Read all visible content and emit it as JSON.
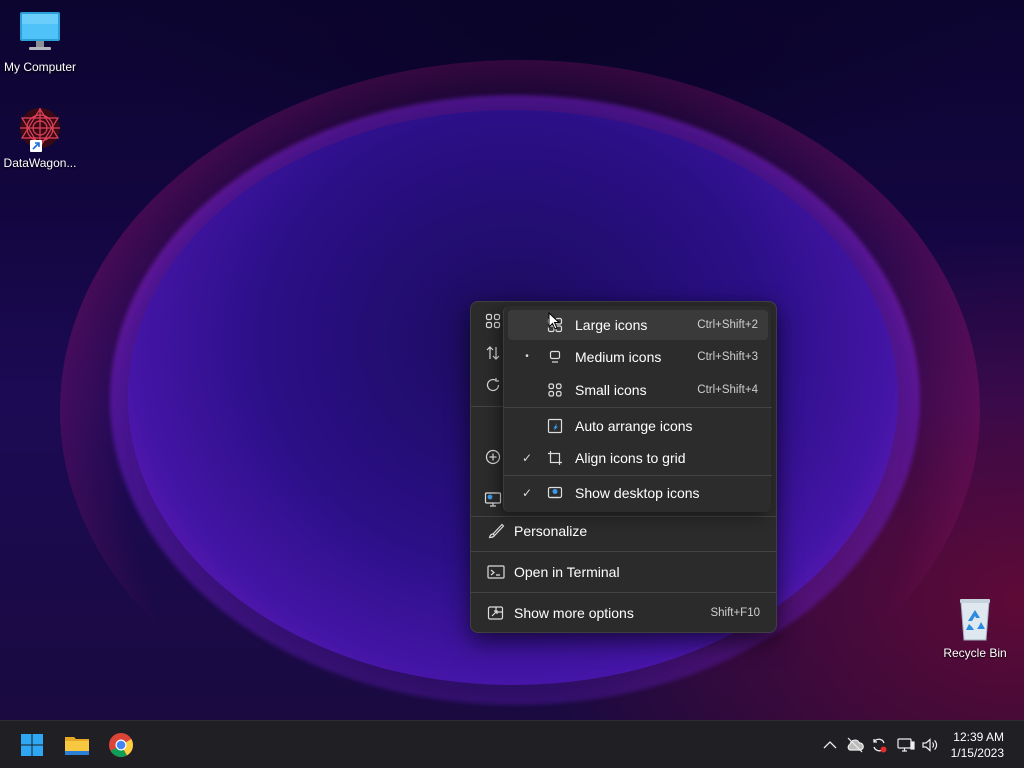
{
  "desktop": {
    "icons": [
      {
        "label": "My Computer"
      },
      {
        "label": "DataWagon..."
      },
      {
        "label": "Recycle Bin"
      }
    ]
  },
  "context_menu": {
    "view_submenu": {
      "items": [
        {
          "label": "Large icons",
          "shortcut": "Ctrl+Shift+2",
          "mark": "",
          "icon": "large-icons-icon"
        },
        {
          "label": "Medium icons",
          "shortcut": "Ctrl+Shift+3",
          "mark": "•",
          "icon": "medium-icons-icon"
        },
        {
          "label": "Small icons",
          "shortcut": "Ctrl+Shift+4",
          "mark": "",
          "icon": "small-icons-icon"
        },
        {
          "label": "Auto arrange icons",
          "shortcut": "",
          "mark": "",
          "icon": "auto-arrange-icon"
        },
        {
          "label": "Align icons to grid",
          "shortcut": "",
          "mark": "✓",
          "icon": "align-grid-icon"
        },
        {
          "label": "Show desktop icons",
          "shortcut": "",
          "mark": "✓",
          "icon": "show-desktop-icon"
        }
      ]
    },
    "items": [
      {
        "label": "Personalize",
        "shortcut": "",
        "icon": "brush-icon"
      },
      {
        "label": "Open in Terminal",
        "shortcut": "",
        "icon": "terminal-icon"
      },
      {
        "label": "Show more options",
        "shortcut": "Shift+F10",
        "icon": "show-more-options-icon"
      }
    ]
  },
  "taskbar": {
    "apps": [
      "start-icon",
      "file-explorer-icon",
      "chrome-icon"
    ],
    "tray_icons": [
      "chevron-up-icon",
      "cloud-offline-icon",
      "sync-icon",
      "network-icon",
      "volume-icon"
    ],
    "clock": {
      "time": "12:39 AM",
      "date": "1/15/2023"
    }
  },
  "colors": {
    "menu_bg": "#2b2b2b",
    "submenu_bg": "#2c2c2c",
    "hover_bg": "#3a3a3a",
    "taskbar_bg": "#1f1f24",
    "accent_blue": "#0a84ff"
  }
}
